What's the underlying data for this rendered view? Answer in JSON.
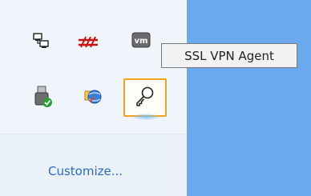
{
  "tray_flyout": {
    "icons": [
      {
        "name": "network-icon"
      },
      {
        "name": "network-disconnected-icon"
      },
      {
        "name": "vmware-icon",
        "label": "vm"
      },
      {
        "name": "usb-safely-remove-icon"
      },
      {
        "name": "globe-app-icon"
      },
      {
        "name": "ssl-vpn-agent-icon"
      }
    ],
    "customize_label": "Customize..."
  },
  "tooltip": {
    "text": "SSL VPN Agent"
  },
  "colors": {
    "flyout_bg": "#f0f5fb",
    "desktop_bg": "#6aa9ee",
    "selection_border": "#f2a21a",
    "link": "#2a69c7"
  }
}
